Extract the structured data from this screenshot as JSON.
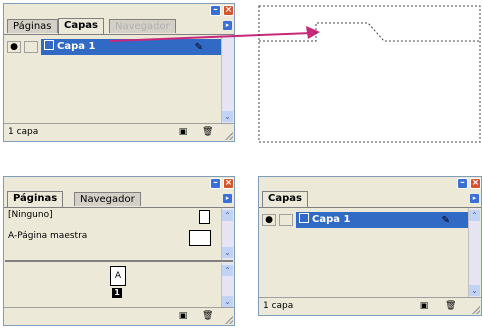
{
  "tabs": {
    "paginas": "Páginas",
    "capas": "Capas",
    "navegador": "Navegador"
  },
  "layers": {
    "layer1": "Capa 1"
  },
  "status": {
    "one_layer": "1 capa"
  },
  "pages": {
    "none_master": "[Ninguno]",
    "master_page": "A-Página maestra",
    "page_prefix": "A",
    "page_number": "1"
  },
  "colors": {
    "selection": "#316ac5",
    "arrow": "#c8287a",
    "title_min": "#3a6fd8",
    "title_close": "#d9532c"
  }
}
